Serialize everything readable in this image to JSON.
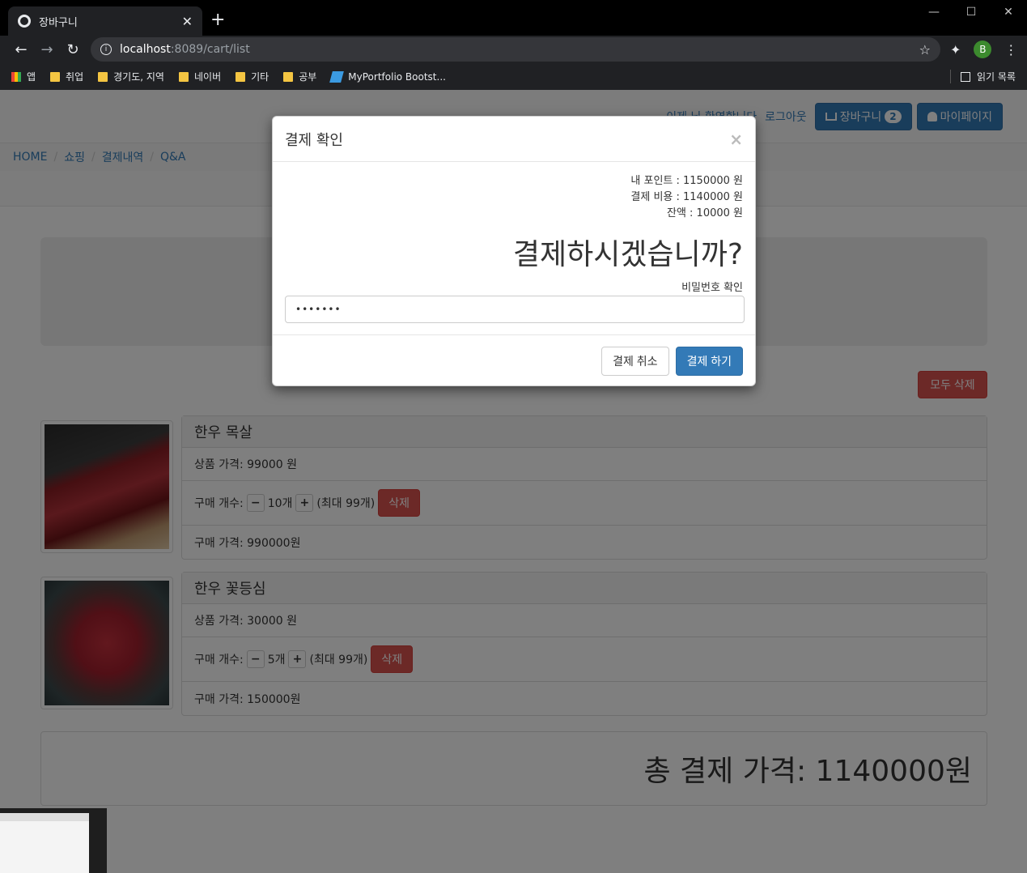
{
  "browser": {
    "tab_title": "장바구니",
    "url_host": "localhost",
    "url_path": ":8089/cart/list",
    "bookmarks": [
      {
        "label": "앱",
        "icon": "apps-icon"
      },
      {
        "label": "취업",
        "icon": "folder-icon"
      },
      {
        "label": "경기도, 지역",
        "icon": "folder-icon"
      },
      {
        "label": "네이버",
        "icon": "folder-icon"
      },
      {
        "label": "기타",
        "icon": "folder-icon"
      },
      {
        "label": "공부",
        "icon": "folder-icon"
      },
      {
        "label": "MyPortfolio Bootst...",
        "icon": "bootstrap-logo-icon"
      }
    ],
    "reading_list": "읽기 목록",
    "profile_initial": "B"
  },
  "header": {
    "welcome": "이제 님 환영합니다",
    "logout": "로그아웃",
    "cart_label": "장바구니",
    "cart_count": "2",
    "mypage_label": "마이페이지"
  },
  "breadcrumb": [
    "HOME",
    "쇼핑",
    "결제내역",
    "Q&A"
  ],
  "cart": {
    "delete_all": "모두 삭제",
    "items": [
      {
        "name": "한우 목살",
        "price_line": "상품 가격: 99000 원",
        "qty_label": "구매 개수:",
        "qty": "10개",
        "max": "(최대 99개)",
        "delete": "삭제",
        "subtotal": "구매 가격: 990000원"
      },
      {
        "name": "한우 꽃등심",
        "price_line": "상품 가격: 30000 원",
        "qty_label": "구매 개수:",
        "qty": "5개",
        "max": "(최대 99개)",
        "delete": "삭제",
        "subtotal": "구매 가격: 150000원"
      }
    ],
    "total": "총 결제 가격: 1140000원"
  },
  "modal": {
    "title": "결제 확인",
    "close": "×",
    "points": "내 포인트 : 1150000 원",
    "cost": "결제 비용 : 1140000 원",
    "balance": "잔액 : 10000 원",
    "question": "결제하시겠습니까?",
    "pw_label": "비밀번호 확인",
    "pw_value": "•••••••",
    "cancel": "결제 취소",
    "confirm": "결제 하기"
  }
}
